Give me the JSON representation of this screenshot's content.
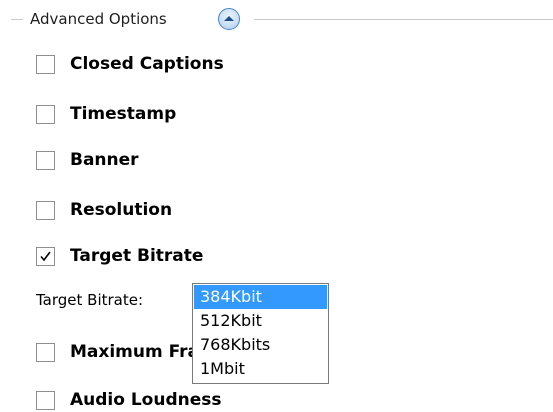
{
  "group": {
    "title": "Advanced Options",
    "toggle_icon": "chevron-up-icon"
  },
  "options": [
    {
      "label": "Closed Captions",
      "checked": false
    },
    {
      "label": "Timestamp",
      "checked": false
    },
    {
      "label": "Banner",
      "checked": false
    },
    {
      "label": "Resolution",
      "checked": false
    },
    {
      "label": "Target Bitrate",
      "checked": true
    },
    {
      "label": "Maximum Frame Latency",
      "checked": false
    },
    {
      "label": "Audio Loudness",
      "checked": false
    }
  ],
  "target_bitrate": {
    "label": "Target Bitrate:",
    "selected": "384Kbit",
    "options": [
      "384Kbit",
      "512Kbit",
      "768Kbits",
      "1Mbit"
    ]
  },
  "colors": {
    "accent": "#3399ff",
    "toggle_border": "#4a86c8",
    "checkbox_border": "#8e8f8f"
  }
}
